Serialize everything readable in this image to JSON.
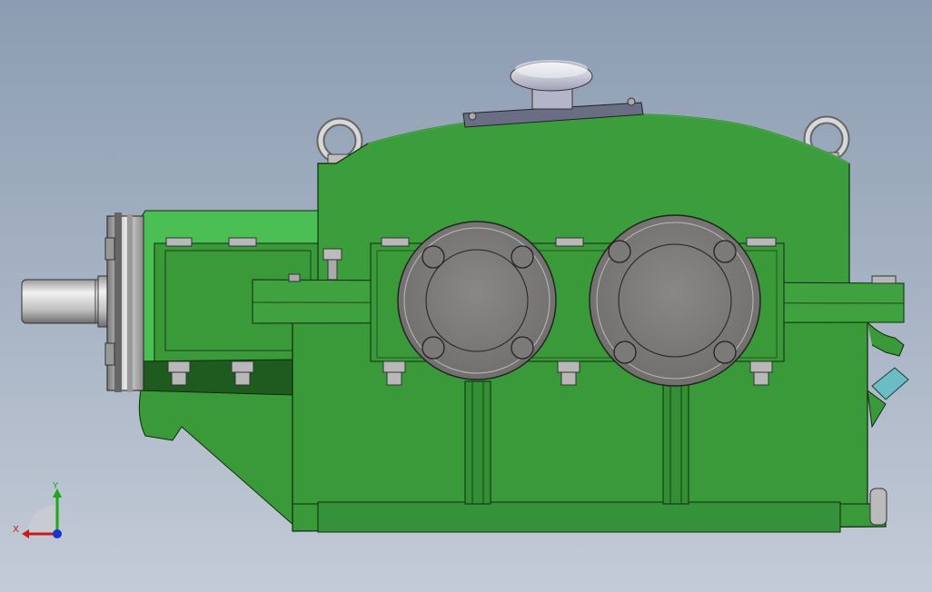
{
  "viewport": {
    "background_top": "#8c9cb2",
    "background_bottom": "#c3cbd6"
  },
  "model": {
    "body_color": "#3a9a3a",
    "body_highlight": "#52bf5a",
    "body_shadow": "#2a7a2a",
    "metal_color": "#8a8a88",
    "steel_color": "#c8c8c8"
  },
  "triad": {
    "x_label": "X",
    "y_label": "Y",
    "x_color": "#cc1a1a",
    "y_color": "#1aa81a",
    "z_color": "#1a33cc",
    "icons": [
      "x-axis-arrow-icon",
      "y-axis-arrow-icon",
      "z-axis-dot-icon"
    ]
  }
}
